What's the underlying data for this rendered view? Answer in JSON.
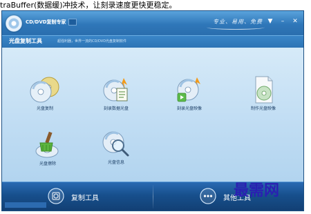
{
  "caption": "traBuffer(数据缓)冲技术，让刻录速度更快更稳定。",
  "window": {
    "title": "CD/DVD复制专家",
    "slogan": "专业、易用、免费",
    "controls": [
      "▼",
      "–",
      "✕"
    ]
  },
  "toolbar": {
    "section_title": "光盘复制工具",
    "section_subtitle": "超强利器，世界一流的CD/DVD光盘复制软件"
  },
  "features": [
    {
      "label": "光盘复制",
      "icon": "disc-copy-icon"
    },
    {
      "label": "刻录数据光盘",
      "icon": "burn-data-disc-icon"
    },
    {
      "label": "刻录光盘映像",
      "icon": "burn-image-icon"
    },
    {
      "label": "制作光盘映像",
      "icon": "make-image-icon"
    },
    {
      "label": "光盘擦除",
      "icon": "disc-erase-icon"
    },
    {
      "label": "光盘信息",
      "icon": "disc-info-icon"
    }
  ],
  "bottom_tabs": [
    {
      "label": "复制工具",
      "icon": "disc-tool-icon"
    },
    {
      "label": "其他工具",
      "icon": "more-dots-icon"
    }
  ],
  "watermark": "最需网"
}
